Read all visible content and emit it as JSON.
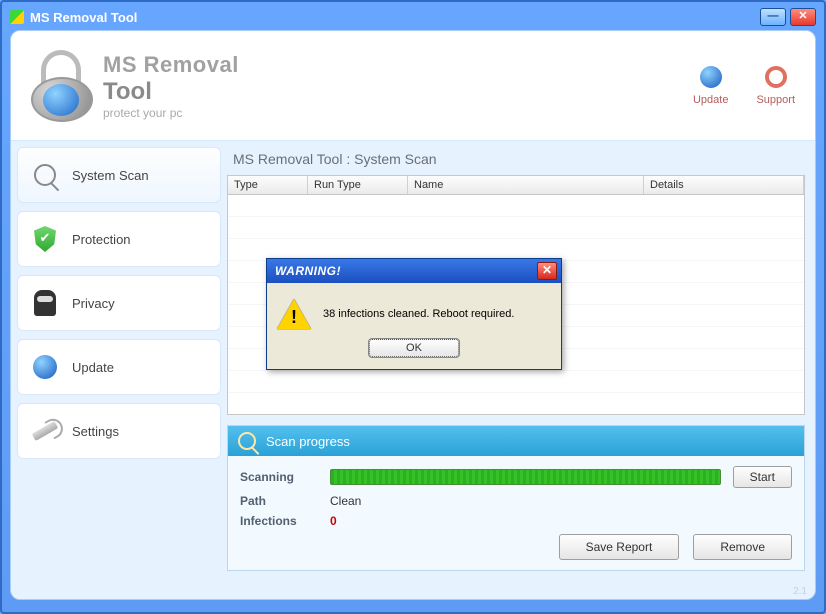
{
  "window": {
    "title": "MS Removal Tool"
  },
  "brand": {
    "line1": "MS Removal",
    "line2": "Tool",
    "tagline": "protect your pc"
  },
  "header_actions": {
    "update": "Update",
    "support": "Support"
  },
  "sidebar": {
    "items": [
      {
        "label": "System Scan"
      },
      {
        "label": "Protection"
      },
      {
        "label": "Privacy"
      },
      {
        "label": "Update"
      },
      {
        "label": "Settings"
      }
    ]
  },
  "main": {
    "panel_title": "MS Removal Tool : System Scan",
    "columns": {
      "type": "Type",
      "run_type": "Run Type",
      "name": "Name",
      "details": "Details"
    }
  },
  "scan": {
    "header": "Scan progress",
    "scanning_label": "Scanning",
    "path_label": "Path",
    "path_value": "Clean",
    "infections_label": "Infections",
    "infections_value": "0",
    "start": "Start",
    "save_report": "Save Report",
    "remove": "Remove"
  },
  "dialog": {
    "title": "WARNING!",
    "message": "38 infections cleaned. Reboot required.",
    "ok": "OK"
  },
  "footer": {
    "version": "2.1"
  }
}
